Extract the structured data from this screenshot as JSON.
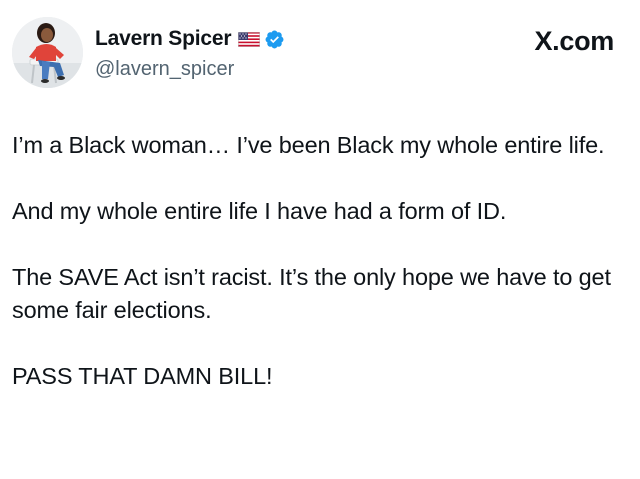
{
  "author": {
    "display_name": "Lavern Spicer",
    "handle": "@lavern_spicer",
    "flag": "us-flag-icon",
    "verified": "verified-badge-icon"
  },
  "site": "X.com",
  "post": {
    "paragraphs": [
      "I’m a Black woman… I’ve been Black my whole entire life.",
      "And my whole entire life I have had a form of ID.",
      "The SAVE Act isn’t racist. It’s the only hope we have to get some fair elections.",
      "PASS THAT DAMN BILL!"
    ]
  },
  "colors": {
    "verified": "#1d9bf0",
    "text": "#0f1419",
    "secondary": "#536471"
  }
}
